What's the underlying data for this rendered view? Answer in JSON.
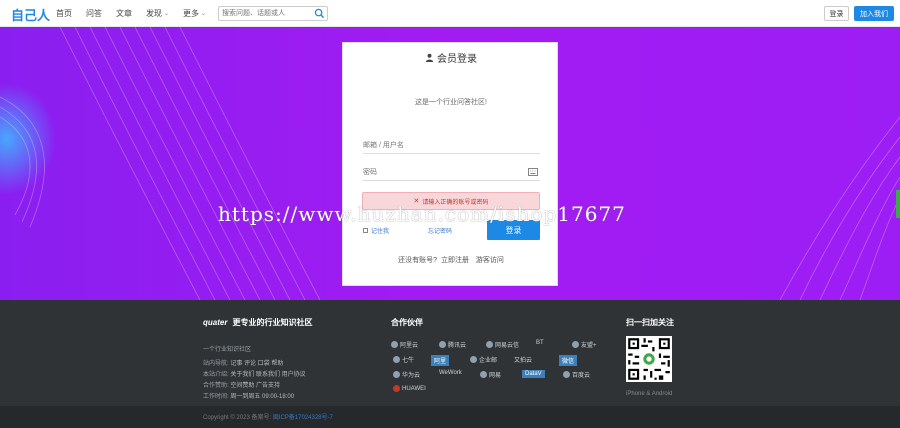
{
  "header": {
    "logo": "自己人",
    "nav": [
      {
        "label": "首页",
        "dropdown": false
      },
      {
        "label": "问答",
        "dropdown": false
      },
      {
        "label": "文章",
        "dropdown": false
      },
      {
        "label": "发现",
        "dropdown": true
      },
      {
        "label": "更多",
        "dropdown": true
      }
    ],
    "search_placeholder": "搜索问题、话题或人",
    "login_label": "登录",
    "join_label": "加入我们"
  },
  "login": {
    "title": "会员登录",
    "subtitle": "这是一个行业问答社区!",
    "username_placeholder": "邮箱 / 用户名",
    "password_placeholder": "密码",
    "error": "请输入正确的账号或密码",
    "remember": "记住我",
    "forgot": "忘记密码",
    "submit": "登录",
    "no_account": "还没有账号?",
    "register": "立即注册",
    "guest": "游客访问"
  },
  "watermark": "https://www.huzhan.com/ishop17677",
  "footer": {
    "brand_logo": "quater",
    "brand_slogan": "更专业的行业知识社区",
    "tagline": "一个行业知识社区",
    "rows": [
      {
        "label": "站内导航:",
        "links": "记事 评论 口袋 帮助"
      },
      {
        "label": "本站介绍:",
        "links": "关于我们 联系我们 用户协议"
      },
      {
        "label": "合作赞助:",
        "links": "空间赞助 广告支持"
      },
      {
        "label": "工作时间:",
        "links": "周一到周五 09:00-18:00"
      }
    ],
    "partners_title": "合作伙伴",
    "partners": [
      "阿里云",
      "腾讯云",
      "网易云信",
      "BT",
      "友盟+",
      "七牛",
      "阿里",
      "企业邮",
      "又拍云",
      "微信",
      "华为云",
      "WeWork",
      "网易",
      "DataV",
      "百度云",
      "HUAWEI"
    ],
    "qr_title": "扫一扫加关注",
    "qr_caption": "iPhone & Android",
    "copyright": "Copyright © 2023 备案号:",
    "icp": "闽ICP备17024328号-7"
  },
  "colors": {
    "accent": "#1e88e5",
    "hero": "#9b1df2",
    "footer": "#2f3336"
  }
}
